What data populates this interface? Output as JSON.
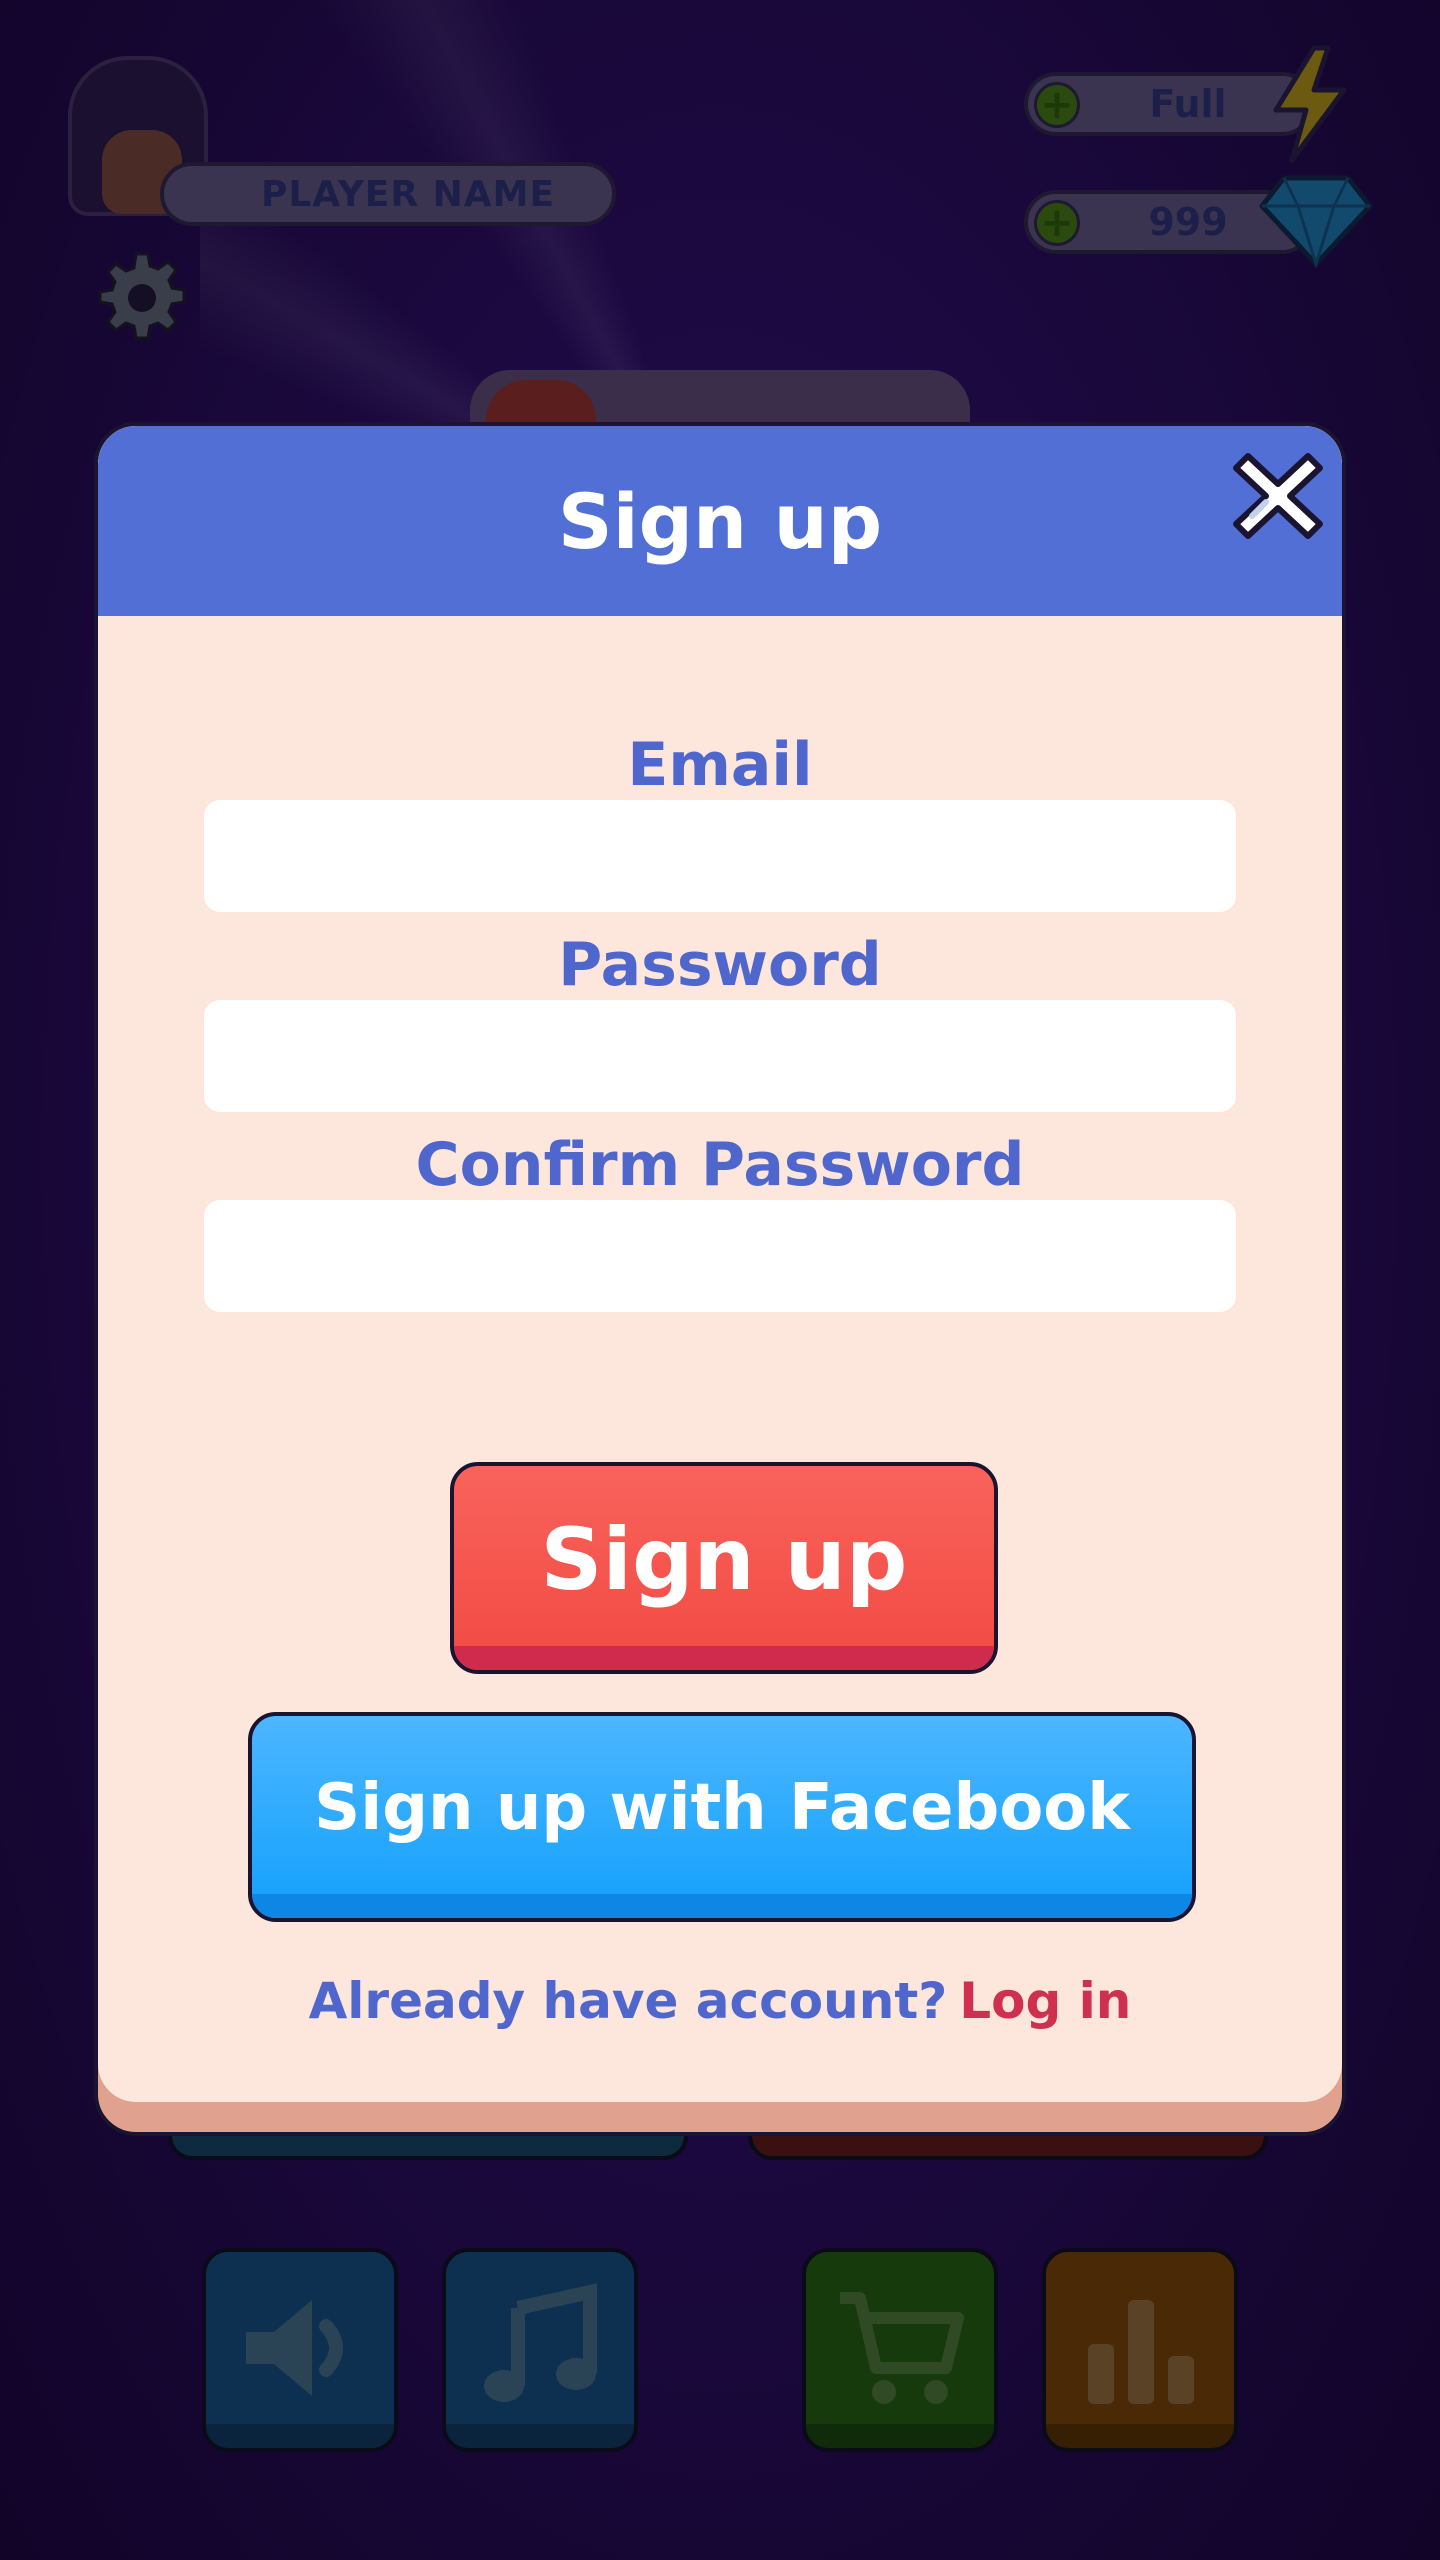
{
  "hud": {
    "player_name": "PLAYER NAME",
    "energy_value": "Full",
    "gems_value": "999",
    "plus_symbol": "+"
  },
  "modal": {
    "title": "Sign up",
    "fields": [
      {
        "label": "Email",
        "value": "",
        "placeholder": ""
      },
      {
        "label": "Password",
        "value": "",
        "placeholder": ""
      },
      {
        "label": "Confirm Password",
        "value": "",
        "placeholder": ""
      }
    ],
    "signup_button": "Sign up",
    "facebook_button": "Sign up with Facebook",
    "login_prompt": "Already have account?",
    "login_link": "Log in"
  },
  "colors": {
    "header_blue": "#526fd6",
    "panel_bg": "#fde6dc",
    "label_blue": "#4f67cc",
    "signup_red": "#f24a42",
    "facebook_blue": "#11a0fb",
    "link_red": "#d0304f"
  },
  "icons": {
    "settings": "gear-icon",
    "energy": "bolt-icon",
    "gems": "gem-icon",
    "close": "close-icon",
    "sound": "speaker-icon",
    "music": "music-note-icon",
    "shop": "cart-icon",
    "leaderboard": "bar-chart-icon"
  }
}
